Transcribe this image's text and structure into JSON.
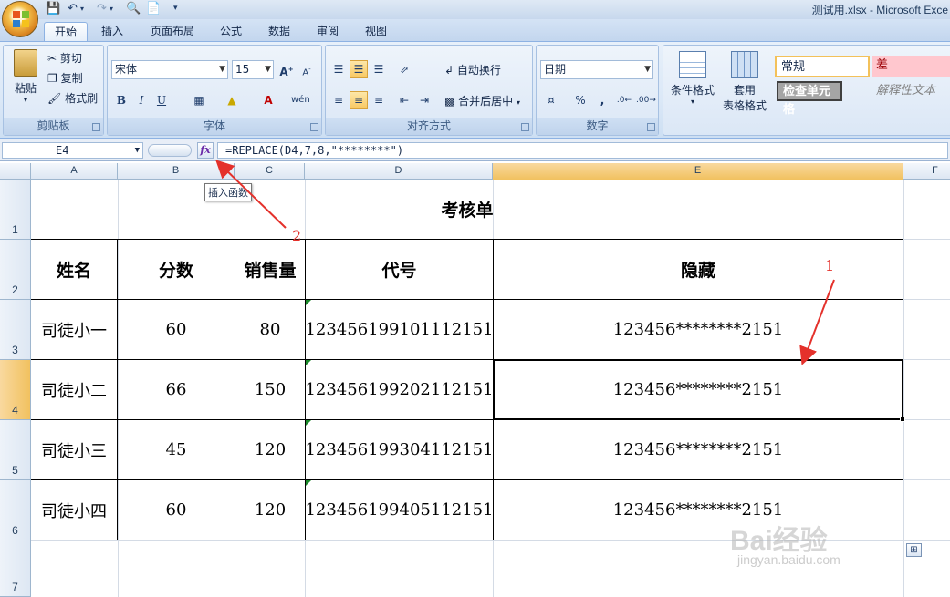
{
  "window": {
    "title": "测试用.xlsx - Microsoft Exce"
  },
  "ribbon": {
    "tabs": [
      "开始",
      "插入",
      "页面布局",
      "公式",
      "数据",
      "审阅",
      "视图"
    ],
    "clipboard": {
      "paste": "粘贴",
      "cut": "剪切",
      "copy": "复制",
      "format_painter": "格式刷",
      "label": "剪贴板"
    },
    "font": {
      "name": "宋体",
      "size": "15",
      "label": "字体",
      "bold": "B",
      "italic": "I",
      "underline": "U"
    },
    "alignment": {
      "wrap_text": "自动换行",
      "merge_center": "合并后居中",
      "label": "对齐方式"
    },
    "number": {
      "format": "日期",
      "percent": "%",
      "comma": ",",
      "label": "数字"
    },
    "styles": {
      "conditional": "条件格式",
      "table_format_line1": "套用",
      "table_format_line2": "表格格式",
      "normal": "常规",
      "bad": "差",
      "check_cell": "检查单元格",
      "explanatory": "解释性文本"
    }
  },
  "formula_bar": {
    "name_box": "E4",
    "formula": "=REPLACE(D4,7,8,\"********\")",
    "tooltip": "插入函数"
  },
  "sheet": {
    "columns": [
      "A",
      "B",
      "C",
      "D",
      "E",
      "F"
    ],
    "rows": [
      "1",
      "2",
      "3",
      "4",
      "5",
      "6",
      "7"
    ],
    "title": "考核单",
    "headers": [
      "姓名",
      "分数",
      "销售量",
      "代号",
      "隐藏"
    ],
    "data": [
      [
        "司徒小一",
        "60",
        "80",
        "123456199101112151",
        "123456********2151"
      ],
      [
        "司徒小二",
        "66",
        "150",
        "123456199202112151",
        "123456********2151"
      ],
      [
        "司徒小三",
        "45",
        "120",
        "123456199304112151",
        "123456********2151"
      ],
      [
        "司徒小四",
        "60",
        "120",
        "123456199405112151",
        "123456********2151"
      ]
    ],
    "active_cell": "E4"
  },
  "annotations": {
    "label1": "1",
    "label2": "2"
  },
  "watermark": {
    "brand": "Bai经验",
    "url": "jingyan.baidu.com"
  },
  "colors": {
    "accent": "#e4312b",
    "selection": "#f1c15f"
  }
}
